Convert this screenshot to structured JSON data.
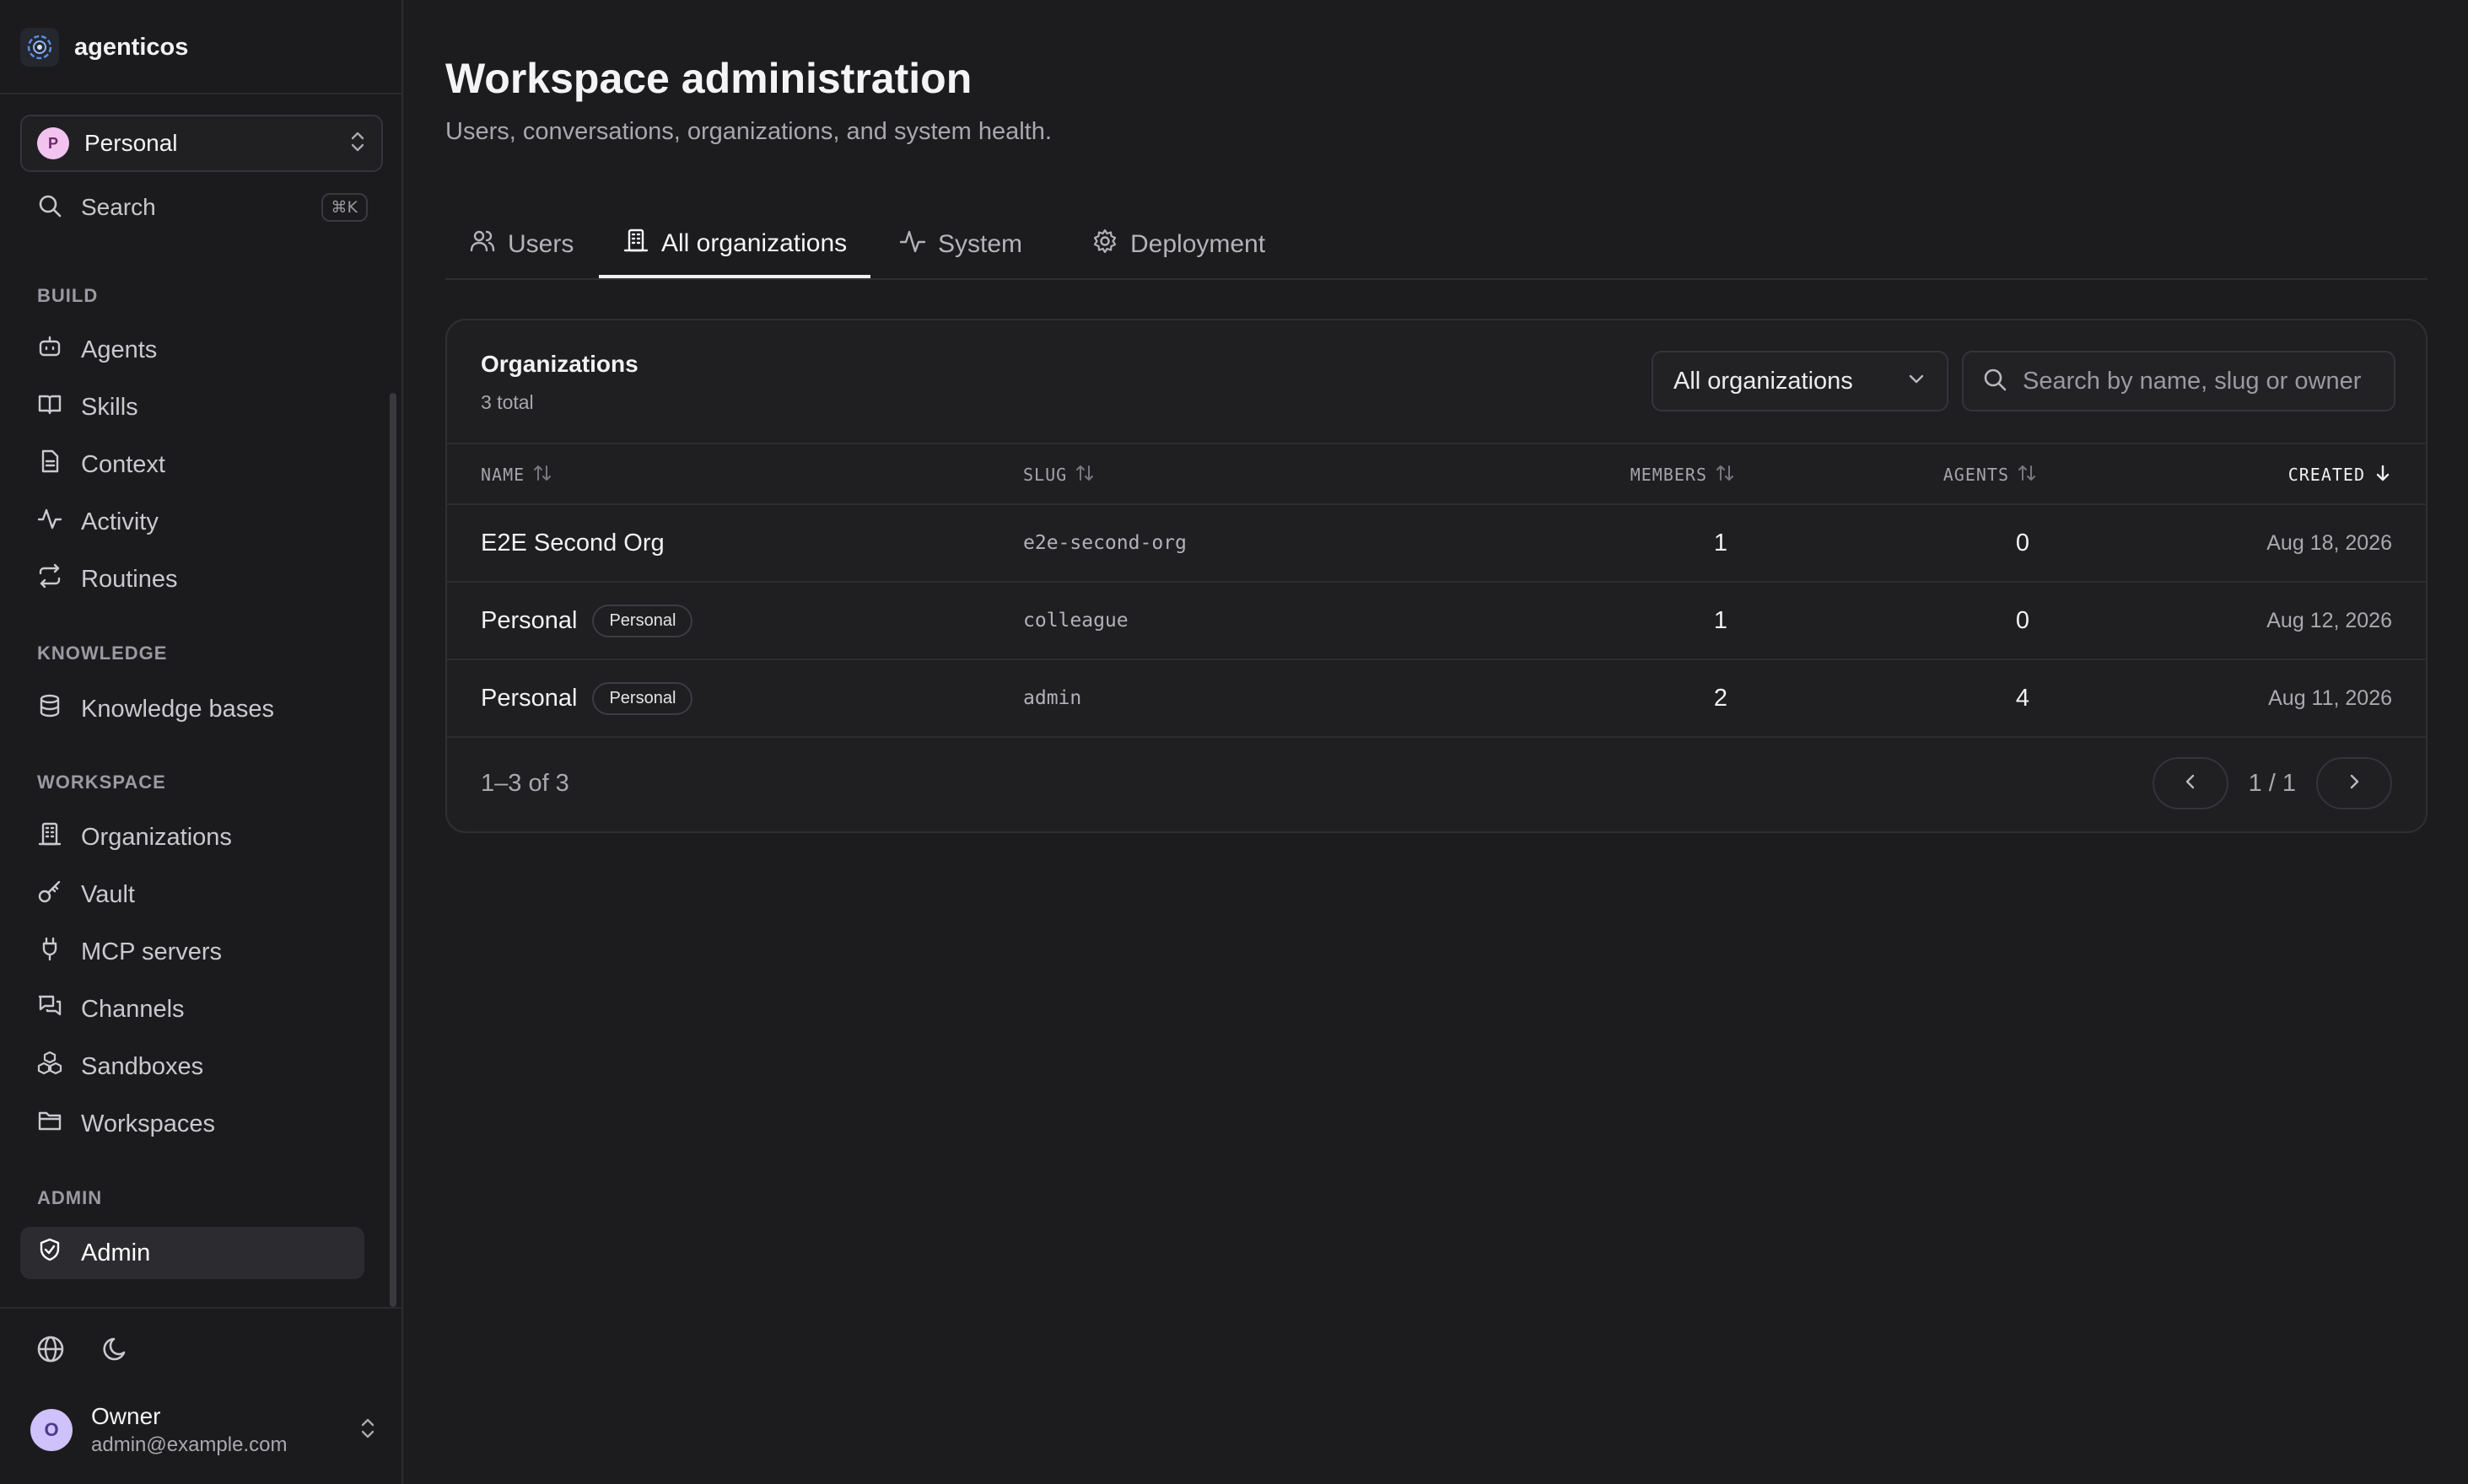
{
  "brand": {
    "name": "agenticos"
  },
  "org_switcher": {
    "initial": "P",
    "name": "Personal"
  },
  "search": {
    "label": "Search",
    "shortcut": "⌘K"
  },
  "sidebar": {
    "sections": [
      {
        "heading": "BUILD",
        "items": [
          {
            "label": "Agents",
            "icon": "bot-icon"
          },
          {
            "label": "Skills",
            "icon": "book-icon"
          },
          {
            "label": "Context",
            "icon": "file-icon"
          },
          {
            "label": "Activity",
            "icon": "activity-icon"
          },
          {
            "label": "Routines",
            "icon": "repeat-icon"
          }
        ]
      },
      {
        "heading": "KNOWLEDGE",
        "items": [
          {
            "label": "Knowledge bases",
            "icon": "database-icon"
          }
        ]
      },
      {
        "heading": "WORKSPACE",
        "items": [
          {
            "label": "Organizations",
            "icon": "building-icon"
          },
          {
            "label": "Vault",
            "icon": "key-icon"
          },
          {
            "label": "MCP servers",
            "icon": "plug-icon"
          },
          {
            "label": "Channels",
            "icon": "messages-icon"
          },
          {
            "label": "Sandboxes",
            "icon": "boxes-icon"
          },
          {
            "label": "Workspaces",
            "icon": "folder-icon"
          }
        ]
      },
      {
        "heading": "ADMIN",
        "items": [
          {
            "label": "Admin",
            "icon": "shield-icon",
            "active": true
          }
        ]
      }
    ]
  },
  "user": {
    "initial": "O",
    "name": "Owner",
    "email": "admin@example.com"
  },
  "page": {
    "title": "Workspace administration",
    "subtitle": "Users, conversations, organizations, and system health."
  },
  "tabs": [
    {
      "label": "Users",
      "icon": "users-icon"
    },
    {
      "label": "All organizations",
      "icon": "building-icon",
      "active": true
    },
    {
      "label": "System",
      "icon": "activity-icon"
    },
    {
      "label": "Deployment",
      "icon": "gear-icon"
    }
  ],
  "organizations": {
    "title": "Organizations",
    "count_text": "3 total",
    "filter_value": "All organizations",
    "search_placeholder": "Search by name, slug or owner",
    "columns": {
      "name": "NAME",
      "slug": "SLUG",
      "members": "MEMBERS",
      "agents": "AGENTS",
      "created": "CREATED"
    },
    "sorted_column": "created",
    "rows": [
      {
        "name": "E2E Second Org",
        "badge": "",
        "slug": "e2e-second-org",
        "members": "1",
        "agents": "0",
        "created": "Aug 18, 2026"
      },
      {
        "name": "Personal",
        "badge": "Personal",
        "slug": "colleague",
        "members": "1",
        "agents": "0",
        "created": "Aug 12, 2026"
      },
      {
        "name": "Personal",
        "badge": "Personal",
        "slug": "admin",
        "members": "2",
        "agents": "4",
        "created": "Aug 11, 2026"
      }
    ],
    "range_text": "1–3 of 3",
    "page_text": "1 / 1"
  },
  "colors": {
    "background": "#1c1c1e",
    "card": "#1f1f21",
    "accent_text": "#f2f2f4",
    "muted_text": "#a9a9ae"
  }
}
